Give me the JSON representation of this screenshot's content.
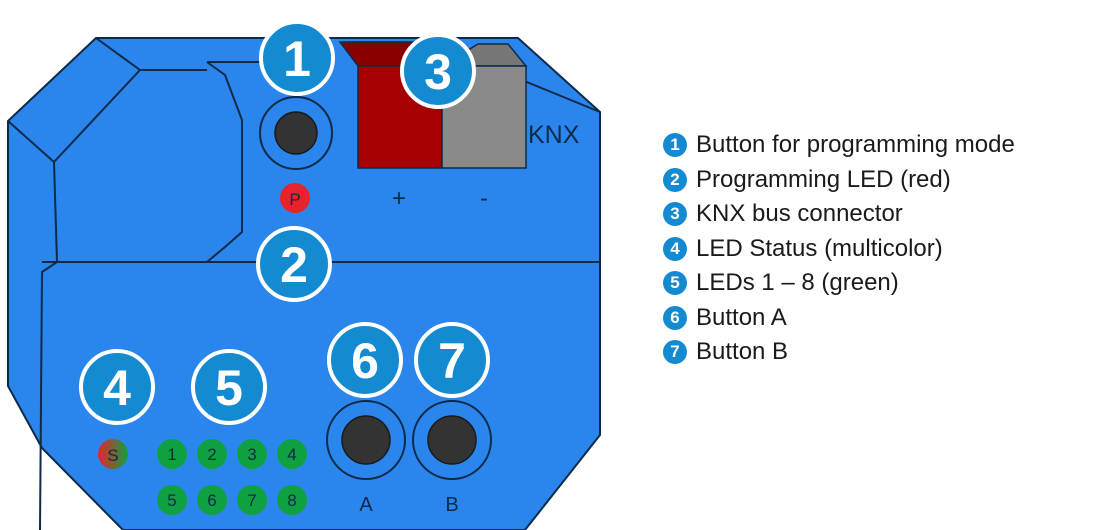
{
  "colors": {
    "housing": "#2a86ec",
    "outline": "#0d2a4a",
    "badge": "#148ad0",
    "terminal_red": "#a70000",
    "terminal_grey": "#8a8a8a",
    "led_red": "#e8232b",
    "led_green": "#0fa040"
  },
  "device": {
    "knx_label": "KNX",
    "plus_label": "+",
    "minus_label": "-",
    "prog_led_label": "P",
    "status_led_label": "S",
    "leds": [
      "1",
      "2",
      "3",
      "4",
      "5",
      "6",
      "7",
      "8"
    ],
    "button_a_label": "A",
    "button_b_label": "B",
    "badges": [
      "1",
      "2",
      "3",
      "4",
      "5",
      "6",
      "7"
    ]
  },
  "legend": [
    {
      "number": "1",
      "text": "Button for programming mode"
    },
    {
      "number": "2",
      "text": "Programming LED (red)"
    },
    {
      "number": "3",
      "text": "KNX bus connector"
    },
    {
      "number": "4",
      "text": "LED Status (multicolor)"
    },
    {
      "number": "5",
      "text": "LEDs 1 – 8 (green)"
    },
    {
      "number": "6",
      "text": "Button A"
    },
    {
      "number": "7",
      "text": "Button B"
    }
  ]
}
